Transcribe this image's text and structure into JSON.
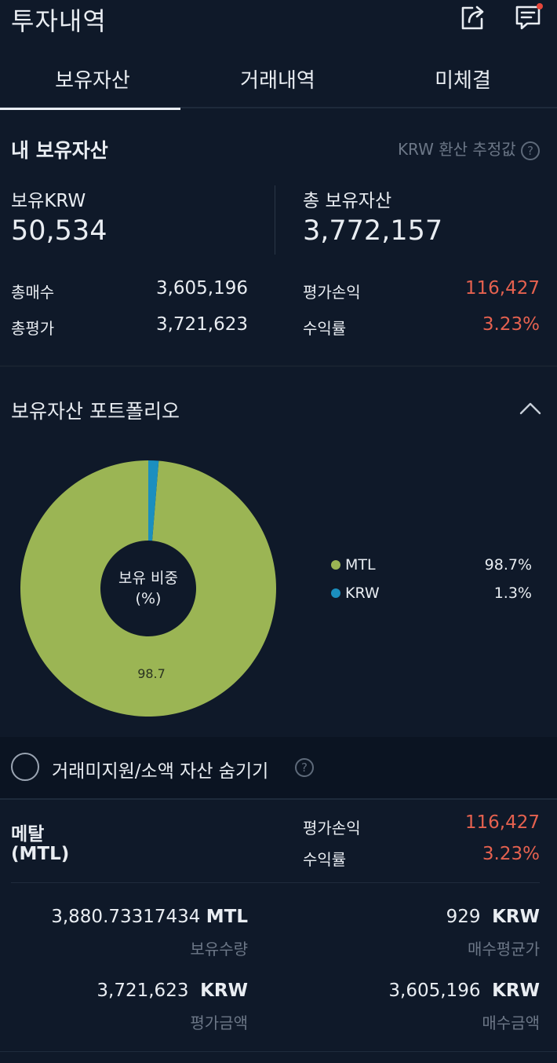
{
  "header": {
    "title": "투자내역",
    "share_icon": "share-icon",
    "chat_icon": "chat-icon",
    "notification_color": "#e5463b"
  },
  "tabs": [
    {
      "label": "보유자산",
      "active": true
    },
    {
      "label": "거래내역",
      "active": false
    },
    {
      "label": "미체결",
      "active": false
    }
  ],
  "summary": {
    "title": "내 보유자산",
    "estimate_label": "KRW 환산 추정값",
    "krw_label": "보유KRW",
    "krw_value": "50,534",
    "total_label": "총 보유자산",
    "total_value": "3,772,157",
    "buy_total_label": "총매수",
    "buy_total_value": "3,605,196",
    "eval_total_label": "총평가",
    "eval_total_value": "3,721,623",
    "pnl_label": "평가손익",
    "pnl_value": "116,427",
    "return_label": "수익률",
    "return_value": "3.23%"
  },
  "portfolio": {
    "title": "보유자산 포트폴리오",
    "center_line1": "보유 비중",
    "center_line2": "(%)",
    "slice_label": "98.7",
    "legend": [
      {
        "name": "MTL",
        "percent": "98.7%",
        "color": "#9bb554"
      },
      {
        "name": "KRW",
        "percent": "1.3%",
        "color": "#1b8fbf"
      }
    ]
  },
  "chart_data": {
    "type": "pie",
    "categories": [
      "MTL",
      "KRW"
    ],
    "values": [
      98.7,
      1.3
    ],
    "colors": [
      "#9bb554",
      "#1b8fbf"
    ],
    "title": "보유자산 포트폴리오",
    "legend": "right"
  },
  "filter": {
    "hide_small_label": "거래미지원/소액 자산 숨기기"
  },
  "asset": {
    "name": "메탈",
    "symbol": "(MTL)",
    "pnl_label": "평가손익",
    "pnl_value": "116,427",
    "return_label": "수익률",
    "return_value": "3.23%",
    "qty_value": "3,880.73317434",
    "qty_unit": "MTL",
    "qty_label": "보유수량",
    "avg_price_value": "929",
    "avg_price_unit": "KRW",
    "avg_price_label": "매수평균가",
    "eval_amount_value": "3,721,623",
    "eval_amount_unit": "KRW",
    "eval_amount_label": "평가금액",
    "buy_amount_value": "3,605,196",
    "buy_amount_unit": "KRW",
    "buy_amount_label": "매수금액"
  }
}
